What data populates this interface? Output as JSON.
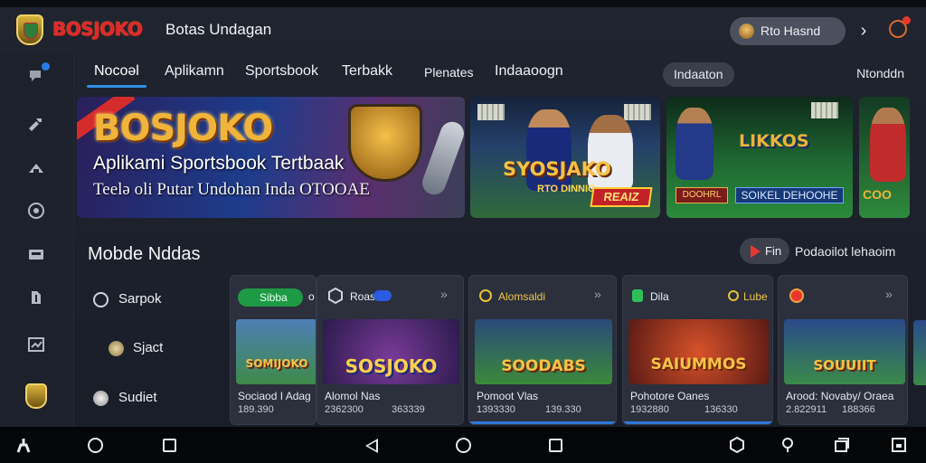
{
  "header": {
    "brand": "BOSJOKO",
    "title": "Botas Undagan",
    "user_name": "Rto  Hasnd",
    "chevron": "›"
  },
  "tabs": {
    "items": [
      "Nocoəl",
      "Aplikamn",
      "Sportsbook",
      "Terbakk",
      "Plenates",
      "Indaaoogn"
    ],
    "pill": "Indaaton",
    "right": "Ntonddn"
  },
  "banners": {
    "main": {
      "big_title": "BOSJOKO",
      "line1": "Aplikami Sportsbook Tertbaak",
      "line2": "Teelə oli Putar Undohan Inda OTOOAE"
    },
    "b2": {
      "title": "SYOSJAKO",
      "sub": "RTO DINNIO",
      "tag": "REAIZ"
    },
    "b3": {
      "title": "LIKKOS",
      "btn_a": "DOOHRL",
      "btn_b": "SOIKEL DEHOOHE"
    },
    "b4": {
      "title": "COO"
    }
  },
  "section": {
    "title": "Mobde Nddas",
    "play_label": "Fin",
    "note": "Podaoilot lehaoim"
  },
  "categories": [
    "Sarpok",
    "Sjact",
    "Sudiet"
  ],
  "cards": [
    {
      "head": "Sibba",
      "head_extra": "o",
      "img_title": "SOMIJOKO",
      "name": "Sociaod I Adag",
      "n1": "189.390",
      "n2": ""
    },
    {
      "head": "Roast",
      "head_extra": "",
      "img_title": "SOSJOKO",
      "name": "Alomol Nas",
      "n1": "2362300",
      "n2": "363339"
    },
    {
      "head": "Alomsaldi",
      "head_extra": "",
      "img_title": "SOODABS",
      "name": "Pomoot Vlas",
      "n1": "1393330",
      "n2": "139.330"
    },
    {
      "head": "Dila",
      "head_extra": "Lube",
      "img_title": "SAIUMMOS",
      "name": "Pohotore Oanes",
      "n1": "1932880",
      "n2": "136330"
    },
    {
      "head": "",
      "head_extra": "",
      "img_title": "SOUUIIT",
      "name": "Arood: Novaby/ Oraea",
      "n1": "2.822911",
      "n2": "188366"
    }
  ],
  "colors": {
    "accent": "#2f8fe6",
    "brand_red": "#e3262e",
    "gold": "#f0b43a",
    "card_bg": "#2b303c"
  }
}
